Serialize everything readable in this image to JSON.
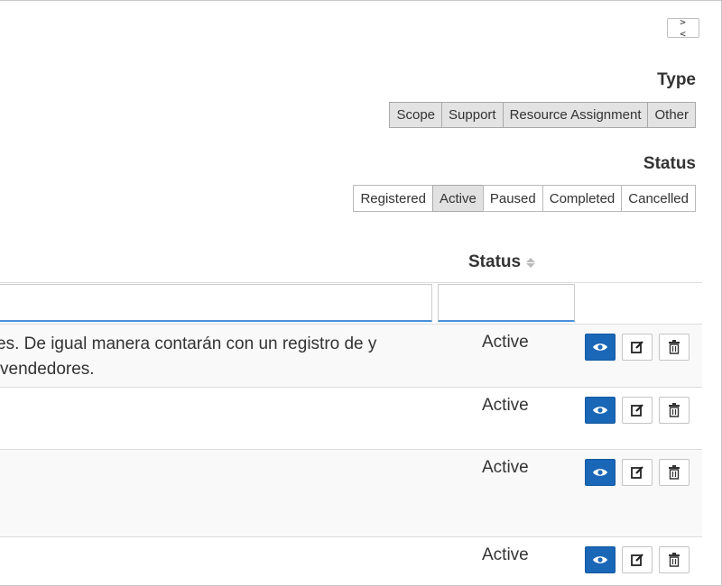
{
  "toolbar": {
    "collapse_label": "> <"
  },
  "type_filter": {
    "title": "Type",
    "options": [
      "Scope",
      "Support",
      "Resource Assignment",
      "Other"
    ]
  },
  "status_filter": {
    "title": "Status",
    "options": [
      "Registered",
      "Active",
      "Paused",
      "Completed",
      "Cancelled"
    ],
    "selected": "Active"
  },
  "table": {
    "columns": {
      "status": "Status"
    },
    "filters": {
      "description_value": "",
      "status_value": ""
    },
    "rows": [
      {
        "description": "es. De igual manera contarán con un registro de y vendedores.",
        "status": "Active"
      },
      {
        "description": "",
        "status": "Active"
      },
      {
        "description": "",
        "status": "Active"
      },
      {
        "description": "",
        "status": "Active"
      }
    ]
  },
  "icons": {
    "view": "eye-icon",
    "edit": "edit-icon",
    "delete": "trash-icon",
    "sort": "sort-icon"
  },
  "colors": {
    "accent": "#1a67b8",
    "filter_underline": "#4a90d9"
  }
}
